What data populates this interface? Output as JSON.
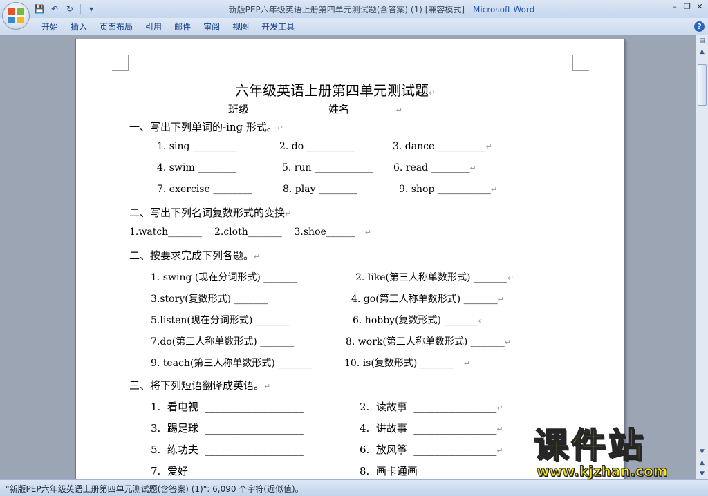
{
  "window": {
    "title_doc": "新版PEP六年级英语上册第四单元测试题(含答案) (1) [兼容模式] - ",
    "title_app": "Microsoft Word"
  },
  "ribbon": {
    "tabs": [
      "开始",
      "插入",
      "页面布局",
      "引用",
      "邮件",
      "审阅",
      "视图",
      "开发工具"
    ]
  },
  "document": {
    "title": "六年级英语上册第四单元测试题",
    "class_name_line": "班级_________          姓名_________",
    "sec1": "一、写出下列单词的-ing 形式。",
    "sec1_r1": [
      "1. sing _________",
      "2. do __________",
      "3. dance __________"
    ],
    "sec1_r2": [
      "4. swim ________",
      "5. run ____________",
      "6. read ________"
    ],
    "sec1_r3": [
      "7. exercise ________",
      "8. play ________",
      "9. shop ___________"
    ],
    "sec2": "二、写出下列名词复数形式的变换",
    "sec2_line": "1.watch_______    2.cloth_______    3.shoe______",
    "sec3": "二、按要求完成下列各题。",
    "sec3_items": [
      [
        "1. swing (现在分词形式) _______",
        "2. like(第三人称单数形式) _______"
      ],
      [
        "3.story(复数形式) _______",
        "4. go(第三人称单数形式) _______"
      ],
      [
        "5.listen(现在分词形式) _______",
        "6. hobby(复数形式) _______"
      ],
      [
        "7.do(第三人称单数形式) _______",
        "8. work(第三人称单数形式) _______"
      ],
      [
        "9. teach(第三人称单数形式) _______",
        "10. is(复数形式) _______"
      ]
    ],
    "sec4": "三、将下列短语翻译成英语。",
    "sec4_items": [
      [
        "1.  看电视  ___________________",
        "2.  读故事  ________________"
      ],
      [
        "3.  踢足球  ___________________",
        "4.  讲故事  ________________"
      ],
      [
        "5.  练功夫  ___________________",
        "6.  放风筝  ________________"
      ],
      [
        "7.  爱好  _________________",
        "8.  画卡通画  _________________"
      ]
    ],
    "para_mark": "↵"
  },
  "statusbar": {
    "text": "\"新版PEP六年级英语上册第四单元测试题(含答案) (1)\": 6,090 个字符(近似值)。"
  },
  "watermark": {
    "cn": "课件站",
    "url": "www.kjzhan.com"
  }
}
